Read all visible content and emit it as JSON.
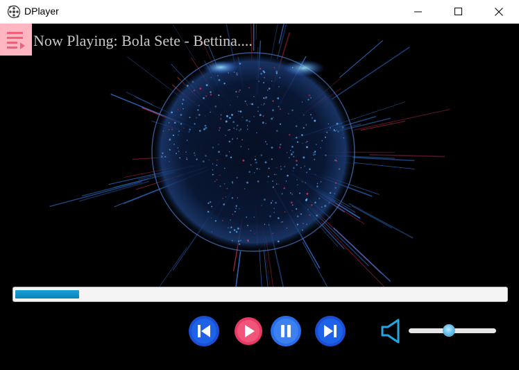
{
  "window": {
    "title": "DPlayer",
    "icon": "film-reel-icon"
  },
  "player": {
    "now_playing": "Now Playing: Bola Sete - Bettina....",
    "progress": 0.13,
    "volume": 0.45,
    "accent_color": "#0b83b8",
    "menu_color": "#ffb6c1",
    "play_color": "#ee3f6a",
    "button_color": "#1b4fd6"
  },
  "controls": {
    "menu": "playlist-menu-icon",
    "previous": "skip-previous-icon",
    "play": "play-icon",
    "pause": "pause-icon",
    "next": "skip-next-icon",
    "volume": "volume-speaker-icon"
  }
}
